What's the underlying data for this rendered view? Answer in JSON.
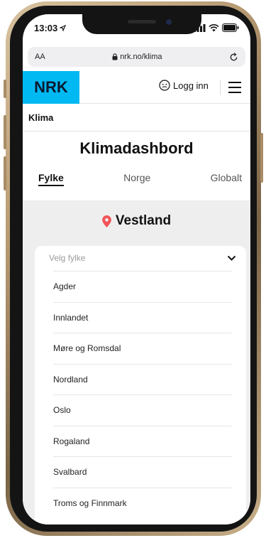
{
  "status_bar": {
    "time": "13:03"
  },
  "browser": {
    "text_size_label": "AA",
    "url": "nrk.no/klima"
  },
  "site_header": {
    "logo": "NRK",
    "login_label": "Logg inn"
  },
  "breadcrumb": {
    "label": "Klima"
  },
  "page": {
    "title": "Klimadashbord",
    "tabs": [
      {
        "label": "Fylke",
        "active": true
      },
      {
        "label": "Norge",
        "active": false
      },
      {
        "label": "Globalt",
        "active": false
      }
    ],
    "location": "Vestland"
  },
  "dropdown": {
    "placeholder": "Velg fylke",
    "options": [
      "Agder",
      "Innlandet",
      "Møre og Romsdal",
      "Nordland",
      "Oslo",
      "Rogaland",
      "Svalbard",
      "Troms og Finnmark"
    ]
  },
  "colors": {
    "nrk_blue": "#00b9f2",
    "pin_red": "#f2555a",
    "panel_gray": "#eeeeee"
  }
}
